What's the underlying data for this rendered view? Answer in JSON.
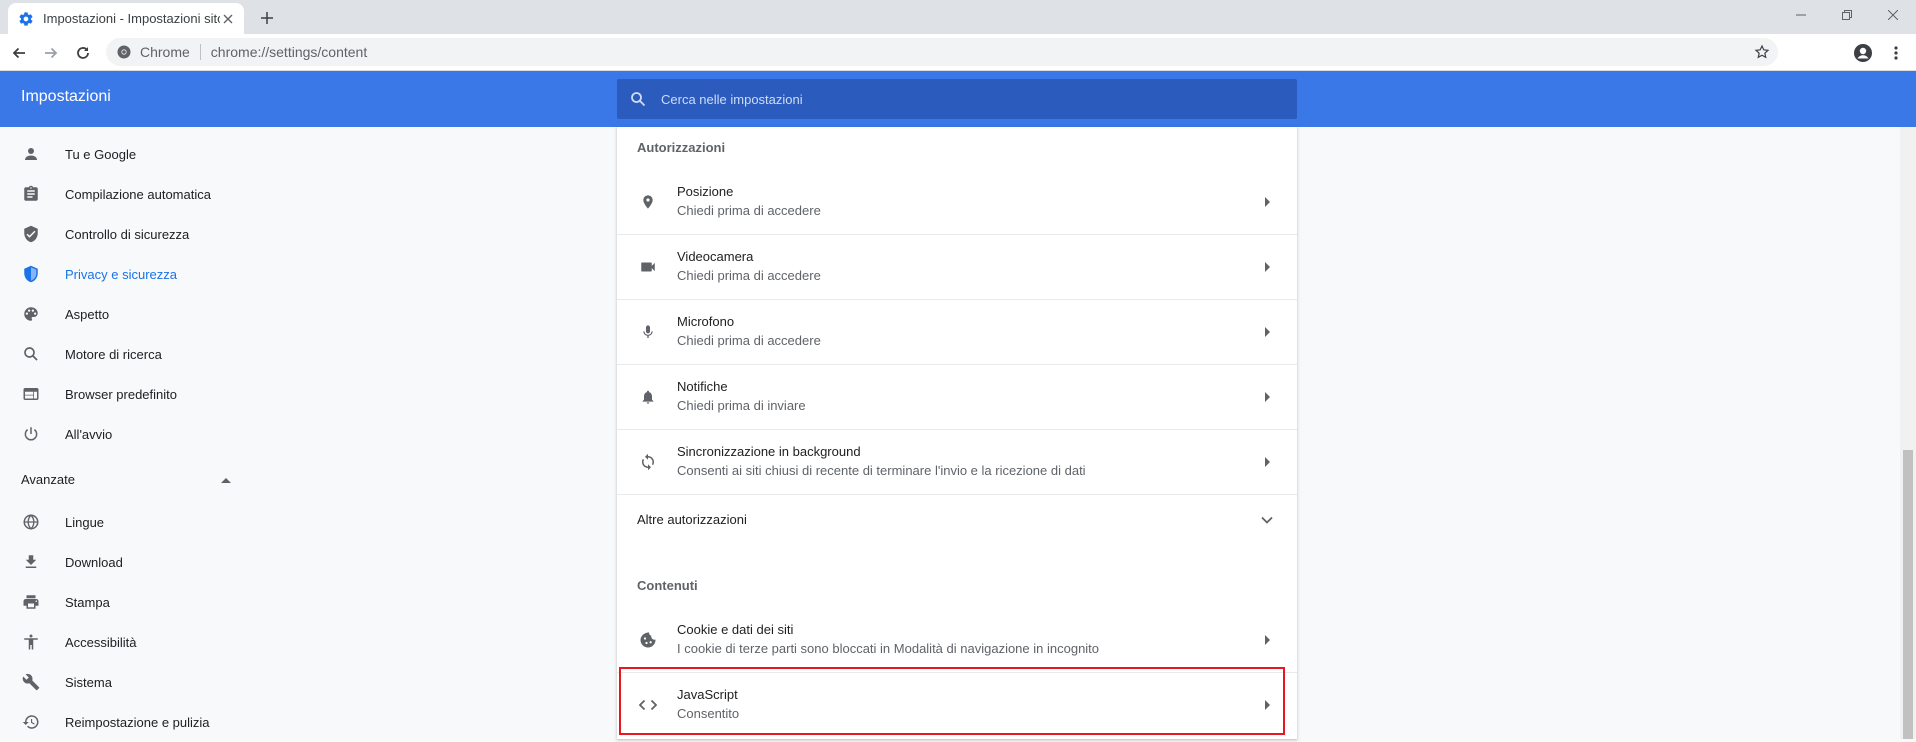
{
  "browser": {
    "tab_title": "Impostazioni - Impostazioni sito",
    "omnibox_chip": "Chrome",
    "url": "chrome://settings/content"
  },
  "header": {
    "title": "Impostazioni",
    "search_placeholder": "Cerca nelle impostazioni"
  },
  "sidebar": {
    "items": [
      {
        "label": "Tu e Google",
        "icon": "person-icon"
      },
      {
        "label": "Compilazione automatica",
        "icon": "clipboard-icon"
      },
      {
        "label": "Controllo di sicurezza",
        "icon": "shield-check-icon"
      },
      {
        "label": "Privacy e sicurezza",
        "icon": "shield-icon"
      },
      {
        "label": "Aspetto",
        "icon": "palette-icon"
      },
      {
        "label": "Motore di ricerca",
        "icon": "search-icon"
      },
      {
        "label": "Browser predefinito",
        "icon": "browser-icon"
      },
      {
        "label": "All'avvio",
        "icon": "power-icon"
      }
    ],
    "advanced_label": "Avanzate",
    "advanced_items": [
      {
        "label": "Lingue",
        "icon": "globe-icon"
      },
      {
        "label": "Download",
        "icon": "download-icon"
      },
      {
        "label": "Stampa",
        "icon": "print-icon"
      },
      {
        "label": "Accessibilità",
        "icon": "accessibility-icon"
      },
      {
        "label": "Sistema",
        "icon": "wrench-icon"
      },
      {
        "label": "Reimpostazione e pulizia",
        "icon": "history-icon"
      }
    ]
  },
  "content": {
    "permissions_title": "Autorizzazioni",
    "permissions": [
      {
        "title": "Posizione",
        "subtitle": "Chiedi prima di accedere",
        "icon": "location-icon"
      },
      {
        "title": "Videocamera",
        "subtitle": "Chiedi prima di accedere",
        "icon": "camera-icon"
      },
      {
        "title": "Microfono",
        "subtitle": "Chiedi prima di accedere",
        "icon": "microphone-icon"
      },
      {
        "title": "Notifiche",
        "subtitle": "Chiedi prima di inviare",
        "icon": "bell-icon"
      },
      {
        "title": "Sincronizzazione in background",
        "subtitle": "Consenti ai siti chiusi di recente di terminare l'invio e la ricezione di dati",
        "icon": "sync-icon"
      }
    ],
    "more_permissions": "Altre autorizzazioni",
    "contents_title": "Contenuti",
    "contents": [
      {
        "title": "Cookie e dati dei siti",
        "subtitle": "I cookie di terze parti sono bloccati in Modalità di navigazione in incognito",
        "icon": "cookie-icon"
      },
      {
        "title": "JavaScript",
        "subtitle": "Consentito",
        "icon": "code-icon"
      }
    ]
  },
  "colors": {
    "header_blue": "#3b78e7",
    "search_blue": "#2a5bbd",
    "active_blue": "#1a73e8",
    "highlight_red": "#e8161e"
  }
}
